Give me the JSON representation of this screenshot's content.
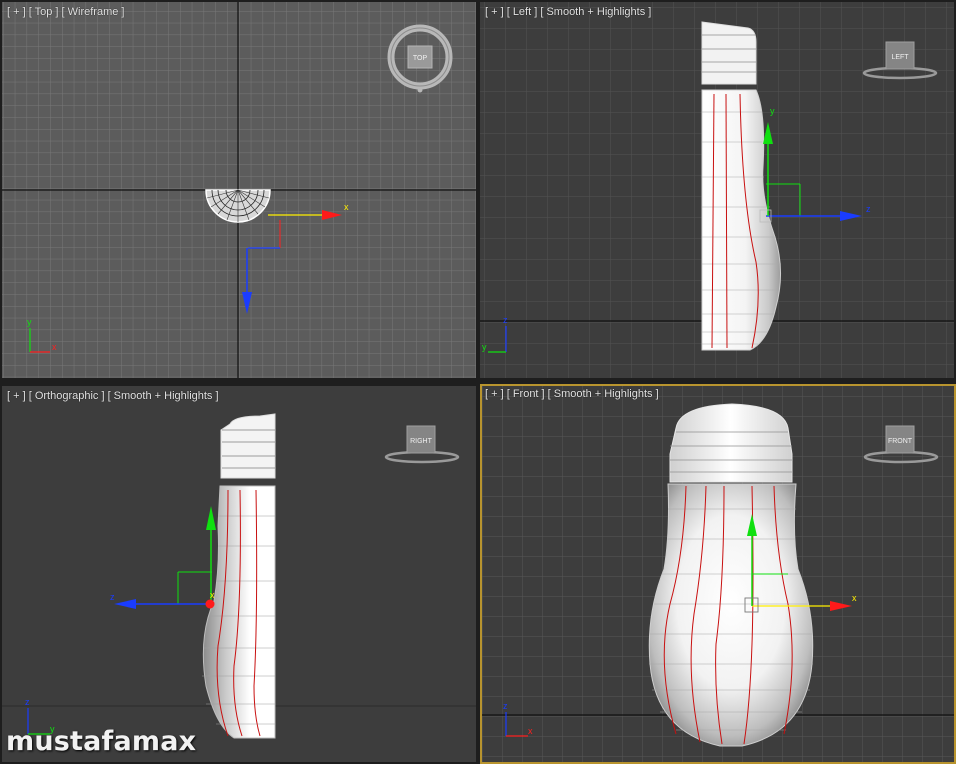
{
  "viewports": {
    "top": {
      "label": "[ + ] [ Top ] [ Wireframe ]",
      "cube": "TOP"
    },
    "left": {
      "label": "[ + ] [ Left ] [ Smooth + Highlights ]",
      "cube": "LEFT"
    },
    "persp": {
      "label": "[ + ] [ Orthographic ] [ Smooth + Highlights ]",
      "cube": "RIGHT"
    },
    "front": {
      "label": "[ + ] [ Front ] [ Smooth + Highlights ]",
      "cube": "FRONT"
    }
  },
  "axes": {
    "x": "x",
    "y": "y",
    "z": "z"
  },
  "colors": {
    "x_axis": "#ff2020",
    "y_axis": "#10e010",
    "z_axis": "#1a3cff",
    "active_frame": "#b8942e"
  },
  "watermark": "mustafamax"
}
